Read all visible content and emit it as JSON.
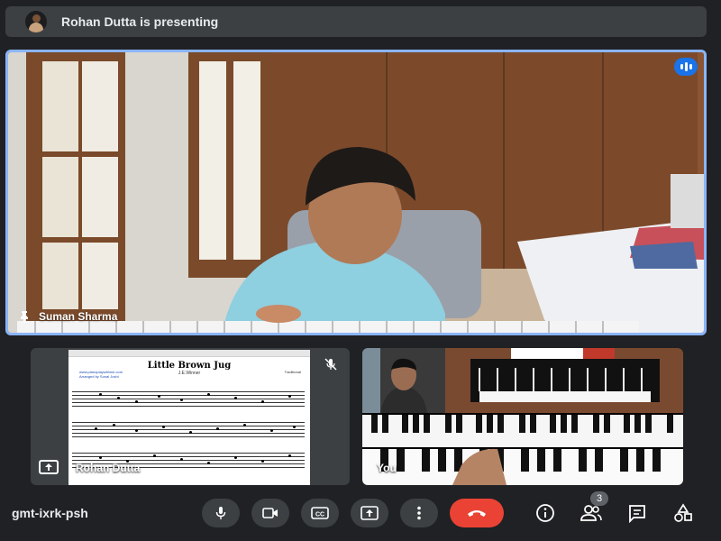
{
  "banner": {
    "text": "Rohan Dutta is presenting"
  },
  "main_tile": {
    "participant_name": "Suman Sharma",
    "speaking_icon": "audio-level-icon",
    "pin_icon": "pin-icon"
  },
  "tiles": [
    {
      "participant_name": "Rohan Dutta",
      "screen_share": {
        "title": "Little Brown Jug",
        "subtitle": "J.E.Winner",
        "website": "www.pianoplaywithme.com",
        "arranger": "Arranged by Sonal Joshi",
        "composer": "Traditional"
      },
      "muted": true
    },
    {
      "participant_name": "You"
    }
  ],
  "bottom_bar": {
    "meeting_code": "gmt-ixrk-psh",
    "controls": [
      "microphone",
      "camera",
      "captions",
      "present",
      "more",
      "end-call"
    ],
    "side_controls": [
      "info",
      "people",
      "chat",
      "activities"
    ],
    "people_count": "3"
  },
  "colors": {
    "background": "#202124",
    "surface": "#3c4043",
    "active_speaker_border": "#8ab4f8",
    "speaking_badge": "#1a73e8",
    "end_call": "#ea4335"
  }
}
